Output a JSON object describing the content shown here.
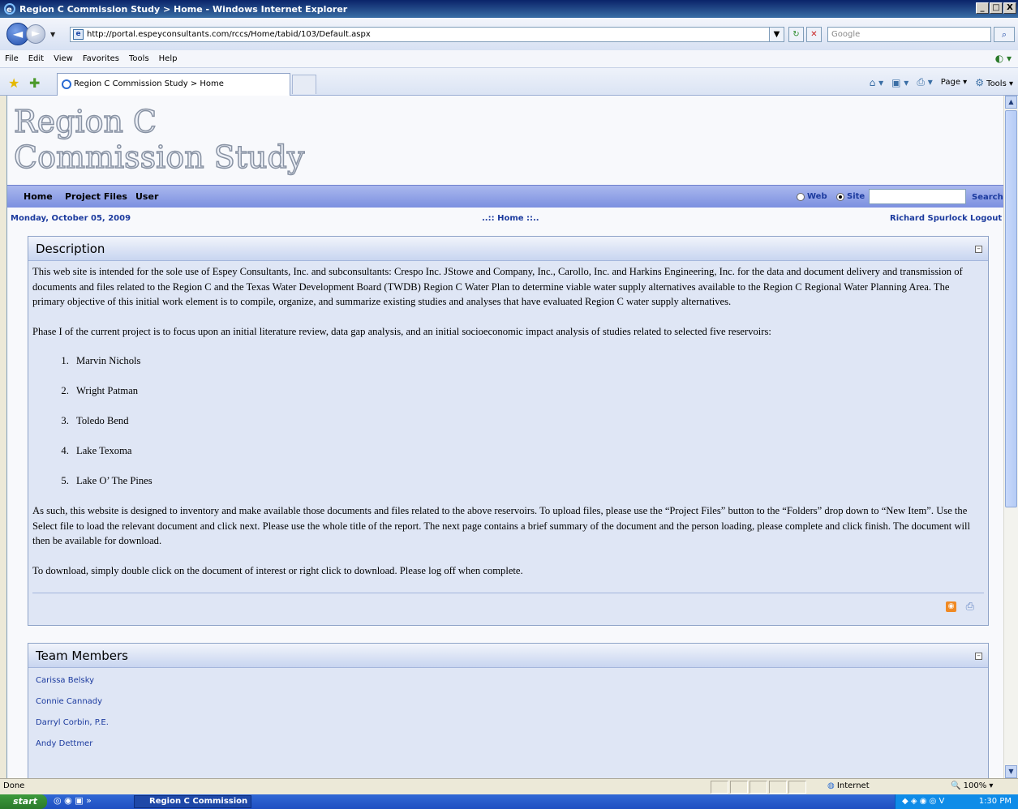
{
  "window": {
    "title": "Region C Commission Study > Home - Windows Internet Explorer",
    "min": "_",
    "max": "□",
    "close": "X"
  },
  "browser": {
    "url": "http://portal.espeyconsultants.com/rccs/Home/tabid/103/Default.aspx",
    "search_placeholder": "Google",
    "menu": [
      "File",
      "Edit",
      "View",
      "Favorites",
      "Tools",
      "Help"
    ],
    "tab_label": "Region C Commission Study > Home",
    "cmd_page": "Page",
    "cmd_tools": "Tools"
  },
  "site": {
    "logo_line1": "Region C",
    "logo_line2": "Commission Study",
    "nav": {
      "home": "Home",
      "project_files": "Project Files",
      "user": "User"
    },
    "search": {
      "web": "Web",
      "site": "Site",
      "button": "Search"
    },
    "date": "Monday, October 05, 2009",
    "breadcrumb": "..:: Home ::..",
    "user_name": "Richard Spurlock",
    "logout": "Logout"
  },
  "description": {
    "title": "Description",
    "para1": "This web site is intended for the sole use of Espey Consultants, Inc. and subconsultants: Crespo Inc. JStowe and Company, Inc., Carollo, Inc. and Harkins Engineering, Inc. for the data and document delivery and transmission of documents and files related to the Region C and the Texas Water Development Board (TWDB) Region C Water Plan to determine viable water supply alternatives available to the Region C Regional Water Planning Area.  The primary objective of this initial work element is to compile, organize, and summarize existing studies and analyses that have evaluated Region C water supply alternatives.",
    "para2": "Phase I of the current project is to focus upon an initial literature review, data gap analysis, and an initial socioeconomic impact analysis of studies related to selected five reservoirs:",
    "reservoirs": [
      "Marvin Nichols",
      "Wright Patman",
      "Toledo Bend",
      "Lake Texoma",
      "Lake O’ The Pines"
    ],
    "para3": "As such, this website is designed to inventory and make available those documents and files related to the above reservoirs.  To upload files, please use the “Project Files” button to the “Folders” drop down to “New Item”.  Use the Select file to load the relevant document and click next.  Please use the whole title of the report.  The next page contains a brief summary of the document and the person loading, please complete and click finish.  The document will then be available for download.",
    "para4": "To download, simply double click on the document of interest or right click to download.  Please log off when complete."
  },
  "team": {
    "title": "Team Members",
    "members": [
      "Carissa Belsky",
      "Connie Cannady",
      "Darryl Corbin, P.E.",
      "Andy Dettmer"
    ]
  },
  "status": {
    "left": "Done",
    "zone": "Internet",
    "zoom": "100%"
  },
  "taskbar": {
    "start": "start",
    "task": "Region C Commission ...",
    "time": "1:30 PM"
  }
}
